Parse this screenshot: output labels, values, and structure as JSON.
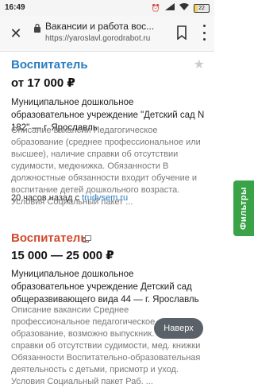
{
  "status_bar": {
    "time": "16:49",
    "battery": "22"
  },
  "browser": {
    "page_title": "Вакансии и работа вос...",
    "url": "https://yaroslavl.gorodrabot.ru"
  },
  "jobs": [
    {
      "title": "Воспитатель",
      "salary": "от 17 000 ₽",
      "employer": "Муниципальное дошкольное образовательное учреждение \"Детский сад N 182\" — г. Ярославль",
      "description": "Описание вакансии Педагогическое образование (среднее профессиональное или высшее), наличие справки об отсутствии судимости, медкнижка. Обязанности В должностные обязанности входит обучение и воспитание детей дошкольного возраста. Условия Социальный пакет ...",
      "posted": "20 часов назад с",
      "source": "trudvsem.ru"
    },
    {
      "title": "Воспитатель",
      "salary": "15 000 — 25 000 ₽",
      "employer": "Муниципальное дошкольное образовательное учреждение Детский сад общеразвивающего вида 44 — г. Ярославль",
      "description": "Описание вакансии Среднее профессиональное педагогическое образование, возможно выпускник. Наличие справки об отсутствии судимости, мед. книжки Обязанности Воспитательно-образовательная деятельность с детьми, присмотр и уход. Условия Социальный пакет Раб. ..."
    }
  ],
  "filters_label": "Фильтры",
  "back_to_top_label": "Наверх",
  "colors": {
    "title_blue": "#2a7bc0",
    "title_red": "#d14a2e",
    "filters_green": "#3aa348"
  }
}
